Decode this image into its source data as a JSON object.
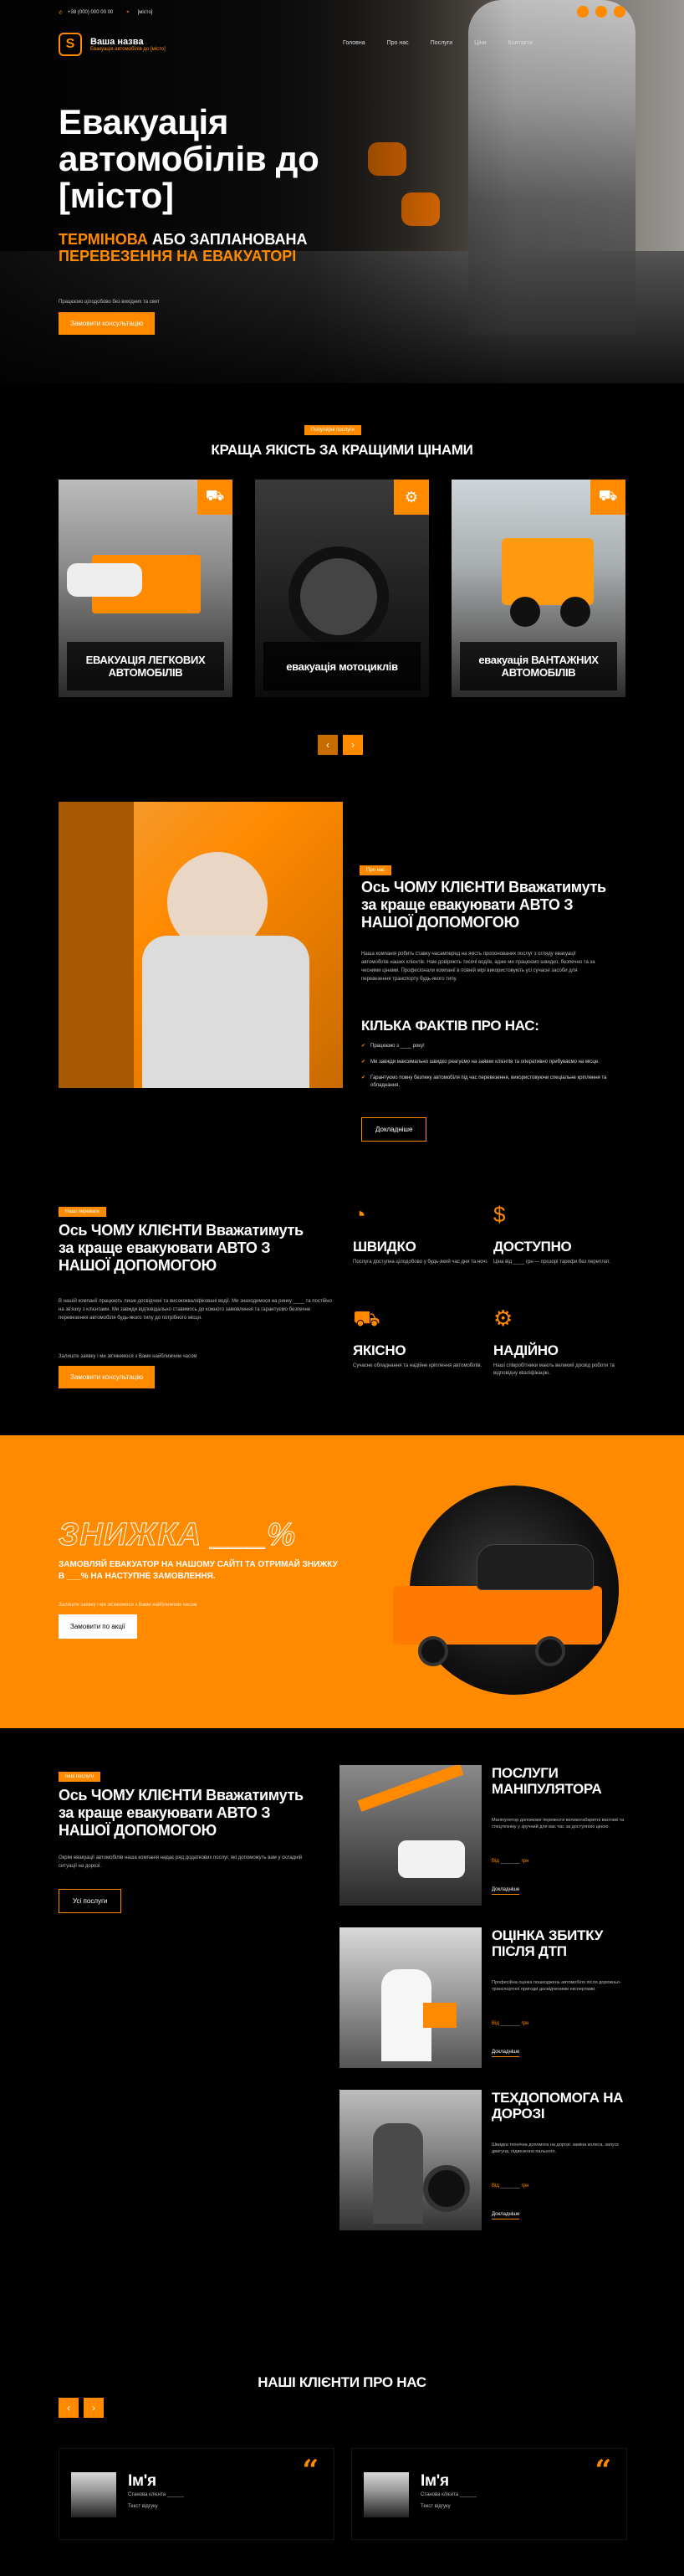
{
  "topbar": {
    "phone": "+38 (000) 000 00 00",
    "city": "[місто]"
  },
  "header": {
    "logo_letter": "S",
    "brand_title": "Ваша назва",
    "brand_sub": "Евакуація автомобілів до [місто]",
    "menu": [
      "Головна",
      "Про нас",
      "Послуги",
      "Ціни",
      "Контакти"
    ]
  },
  "hero": {
    "title": "Евакуація автомобілів до [місто]",
    "sub_a": "ТЕРМІНОВА",
    "sub_b": "АБО ЗАПЛАНОВАНА",
    "sub_c": "ПЕРЕВЕЗЕННЯ НА ЕВАКУАТОРІ",
    "small": "Працюємо цілодобово без вихідних та свят",
    "button": "Замовити консультацію"
  },
  "services": {
    "tag": "Популярні послуги",
    "title": "КРАЩА ЯКІСТЬ ЗА КРАЩИМИ ЦІНАМИ",
    "cards": [
      {
        "label": "ЕВАКУАЦІЯ ЛЕГКОВИХ АВТОМОБІЛІВ",
        "icon": "tow-truck-icon"
      },
      {
        "label": "евакуація мотоциклів",
        "icon": "motorcycle-icon"
      },
      {
        "label": "евакуація ВАНТАЖНИХ АВТОМОБІЛІВ",
        "icon": "truck-icon"
      }
    ],
    "prev": "‹",
    "next": "›"
  },
  "why1": {
    "tag": "Про нас",
    "title": "Ось ЧОМУ КЛІЄНТИ Вважатимуть за краще евакуювати АВТО З НАШОЇ ДОПОМОГОЮ",
    "text": "Наша компанія робить ставку насамперед на якість пропонованих послуг з огляду евакуації автомобілів наших клієнтів. Нам довіряють тисячі водіїв, адже ми працюємо швидко, безпечно та за чесними цінами. Професіонали компанії в повній мірі використовують усі сучасні засоби для перевезення транспорту будь-якого типу.",
    "facts_title": "КІЛЬКА ФАКТІВ ПРО НАС:",
    "facts": [
      "Працюємо з ____ року!",
      "Ми завжди максимально швидко реагуємо на заявки клієнтів та оперативно прибуваємо на місце.",
      "Гарантуємо повну безпеку автомобіля під час перевезення, використовуючи спеціальне кріплення та обладнання."
    ],
    "button": "Докладніше"
  },
  "why2": {
    "tag": "Наші переваги",
    "title": "Ось ЧОМУ КЛІЄНТИ Вважатимуть за краще евакуювати АВТО З НАШОЇ ДОПОМОГОЮ",
    "text": "В нашій компанії працюють лише досвідчені та висококваліфіковані водії. Ми знаходимося на ринку ____ та постійно на зв'язку з клієнтами. Ми завжди відповідально ставимось до кожного замовлення та гарантуємо безпечне перевезення автомобіля будь-якого типу до потрібного місця.",
    "small": "Залиште заявку і ми зв'яжемося з Вами найближчим часом",
    "button": "Замовити консультацію",
    "features": [
      {
        "icon": "speedometer-icon",
        "glyph": "◔",
        "title": "ШВИДКО",
        "desc": "Послуга доступна цілодобово у будь-який час дня та ночі."
      },
      {
        "icon": "money-bag-icon",
        "glyph": "$",
        "title": "ДОСТУПНО",
        "desc": "Ціна від ____ грн — прозорі тарифи без переплат."
      },
      {
        "icon": "tow-truck-icon",
        "glyph": "⛟",
        "title": "ЯКІСНО",
        "desc": "Сучасне обладнання та надійне кріплення автомобілів."
      },
      {
        "icon": "gears-icon",
        "glyph": "⚙",
        "title": "НАДІЙНО",
        "desc": "Наші співробітники мають великий досвід роботи та відповідну кваліфікацію."
      }
    ]
  },
  "discount": {
    "title": "ЗНИЖКА ___%",
    "sub": "ЗАМОВЛЯЙ ЕВАКУАТОР НА НАШОМУ САЙТІ ТА ОТРИМАЙ ЗНИЖКУ В ___% НА НАСТУПНЕ ЗАМОВЛЕННЯ.",
    "small": "Залиште заявку і ми зв'яжемося з Вами найближчим часом",
    "button": "Замовити по акції"
  },
  "svc2": {
    "tag": "Інші послуги",
    "title": "Ось ЧОМУ КЛІЄНТИ Вважатимуть за краще евакуювати АВТО З НАШОЇ ДОПОМОГОЮ",
    "text": "Окрім евакуації автомобілів наша компанія надає ряд додаткових послуг, які допоможуть вам у складній ситуації на дорозі.",
    "button": "Усі послуги",
    "items": [
      {
        "title": "ПОСЛУГИ МАНІПУЛЯТОРА",
        "desc": "Маніпулятор допоможе перевезти великогабаритні вантажі та спецтехніку у зручний для вас час за доступною ціною.",
        "price_a": "Від",
        "price_b": "грн",
        "more": "Докладніше"
      },
      {
        "title": "ОЦІНКА ЗБИТКУ ПІСЛЯ ДТП",
        "desc": "Професійна оцінка пошкоджень автомобіля після дорожньо-транспортної пригоди досвідченими експертами.",
        "price_a": "Від",
        "price_b": "грн",
        "more": "Докладніше"
      },
      {
        "title": "ТЕХДОПОМОГА НА ДОРОЗІ",
        "desc": "Швидка технічна допомога на дорозі: заміна колеса, запуск двигуна, підвезення пального.",
        "price_a": "Від",
        "price_b": "грн",
        "more": "Докладніше"
      }
    ]
  },
  "testimonials": {
    "title": "НАШІ КЛІЄНТИ ПРО НАС",
    "prev": "‹",
    "next": "›",
    "items": [
      {
        "name": "Ім'я",
        "role": "Станова клієнта ______",
        "text": "Текст відгуку"
      },
      {
        "name": "Ім'я",
        "role": "Станова клієнта ______",
        "text": "Текст відгуку"
      }
    ]
  }
}
